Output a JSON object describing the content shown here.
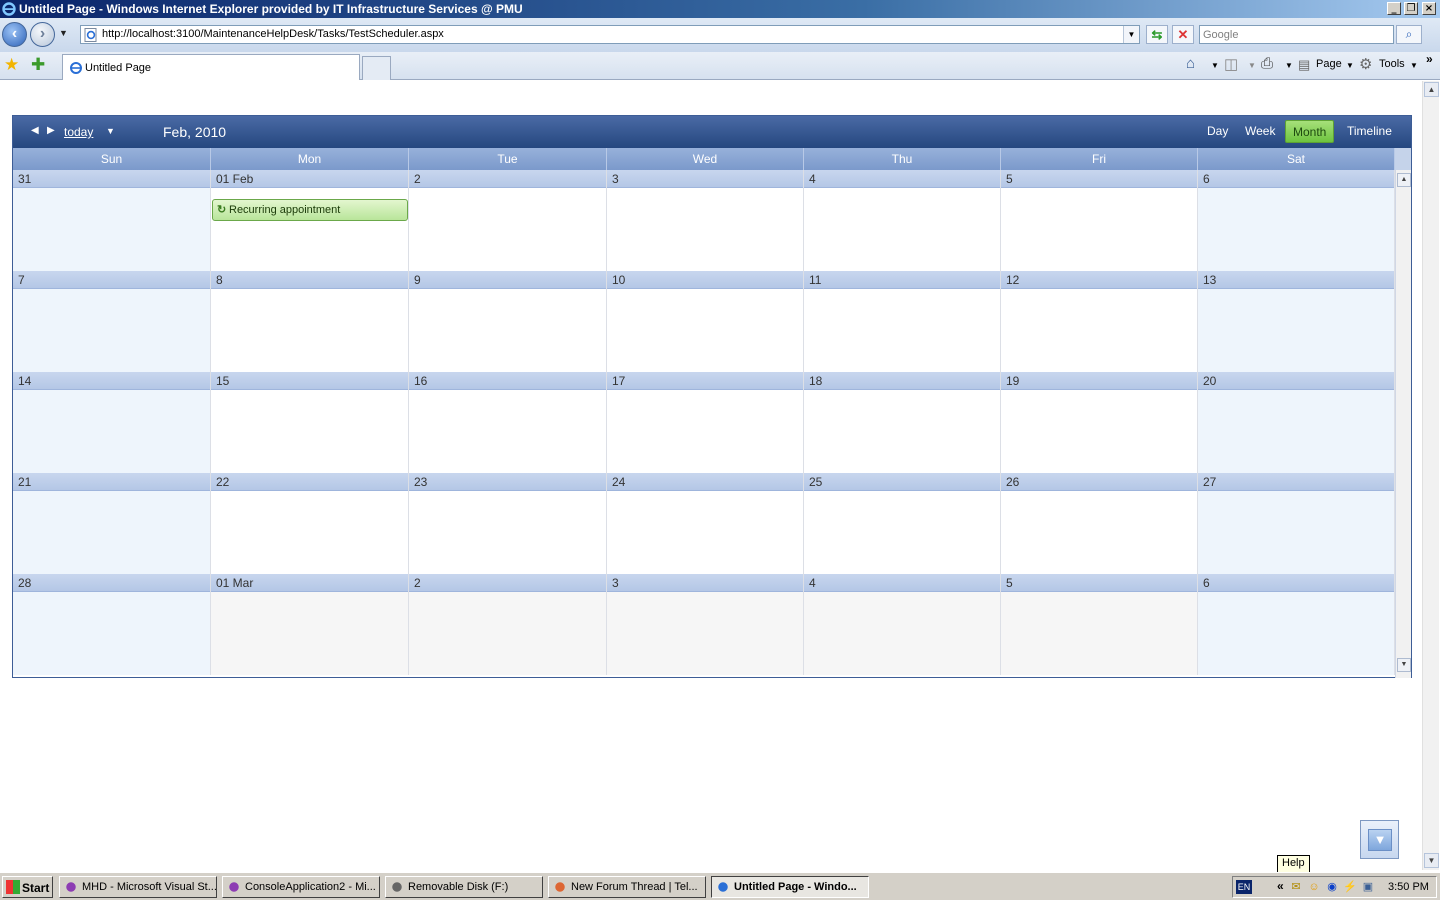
{
  "window": {
    "title": "Untitled Page - Windows Internet Explorer provided by IT Infrastructure Services @ PMU"
  },
  "navbar": {
    "url": "http://localhost:3100/MaintenanceHelpDesk/Tasks/TestScheduler.aspx",
    "search_placeholder": "Google"
  },
  "tabbar": {
    "active_tab_label": "Untitled Page",
    "page_label": "Page",
    "tools_label": "Tools"
  },
  "scheduler": {
    "today_label": "today",
    "period_label": "Feb, 2010",
    "views": [
      "Day",
      "Week",
      "Month",
      "Timeline"
    ],
    "selected_view": "Month",
    "day_names": [
      "Sun",
      "Mon",
      "Tue",
      "Wed",
      "Thu",
      "Fri",
      "Sat"
    ],
    "weeks": [
      [
        "31",
        "01 Feb",
        "2",
        "3",
        "4",
        "5",
        "6"
      ],
      [
        "7",
        "8",
        "9",
        "10",
        "11",
        "12",
        "13"
      ],
      [
        "14",
        "15",
        "16",
        "17",
        "18",
        "19",
        "20"
      ],
      [
        "21",
        "22",
        "23",
        "24",
        "25",
        "26",
        "27"
      ],
      [
        "28",
        "01 Mar",
        "2",
        "3",
        "4",
        "5",
        "6"
      ]
    ],
    "appointment": {
      "subject": "Recurring appointment"
    }
  },
  "help_tooltip": "Help",
  "taskbar": {
    "start_label": "Start",
    "tasks": [
      {
        "label": "MHD - Microsoft Visual St...",
        "active": false
      },
      {
        "label": "ConsoleApplication2 - Mi...",
        "active": false
      },
      {
        "label": "Removable Disk (F:)",
        "active": false
      },
      {
        "label": "New Forum Thread | Tel...",
        "active": false
      },
      {
        "label": "Untitled Page - Windo...",
        "active": true
      }
    ],
    "language": "EN",
    "clock": "3:50 PM"
  }
}
